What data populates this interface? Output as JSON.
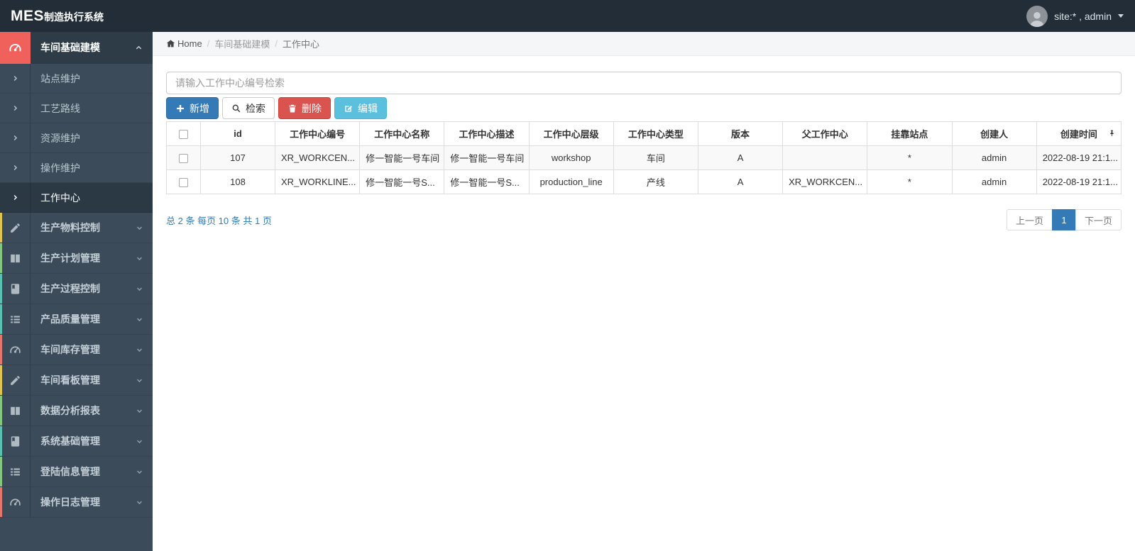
{
  "topbar": {
    "brand_primary": "MES",
    "brand_secondary": "制造执行系统",
    "user_label": "site:* , admin"
  },
  "breadcrumb": {
    "home_label": "Home",
    "separator": "/",
    "items": [
      "车间基础建模",
      "工作中心"
    ]
  },
  "sidebar": {
    "active_group": {
      "label": "车间基础建模",
      "icon": "tachometer-icon",
      "children": [
        {
          "label": "站点维护",
          "active": false
        },
        {
          "label": "工艺路线",
          "active": false
        },
        {
          "label": "资源维护",
          "active": false
        },
        {
          "label": "操作维护",
          "active": false
        },
        {
          "label": "工作中心",
          "active": true
        }
      ]
    },
    "items": [
      {
        "label": "生产物料控制",
        "icon": "pencil-icon",
        "strip_color": "#dfc452"
      },
      {
        "label": "生产计划管理",
        "icon": "columns-icon",
        "strip_color": "#84c87f"
      },
      {
        "label": "生产过程控制",
        "icon": "book-icon",
        "strip_color": "#58c2b1"
      },
      {
        "label": "产品质量管理",
        "icon": "list-icon",
        "strip_color": "#58c2b1"
      },
      {
        "label": "车间库存管理",
        "icon": "tachometer-icon",
        "strip_color": "#e4766c"
      },
      {
        "label": "车间看板管理",
        "icon": "pencil-icon",
        "strip_color": "#dfc452"
      },
      {
        "label": "数据分析报表",
        "icon": "columns-icon",
        "strip_color": "#84c87f"
      },
      {
        "label": "系统基础管理",
        "icon": "book-icon",
        "strip_color": "#58c2b1"
      },
      {
        "label": "登陆信息管理",
        "icon": "list-icon",
        "strip_color": "#84c87f"
      },
      {
        "label": "操作日志管理",
        "icon": "tachometer-icon",
        "strip_color": "#e4766c"
      }
    ]
  },
  "search": {
    "placeholder": "请输入工作中心编号检索",
    "value": ""
  },
  "toolbar": {
    "add_label": "新增",
    "search_label": "检索",
    "delete_label": "删除",
    "edit_label": "编辑"
  },
  "table": {
    "columns": [
      "id",
      "工作中心编号",
      "工作中心名称",
      "工作中心描述",
      "工作中心层级",
      "工作中心类型",
      "版本",
      "父工作中心",
      "挂靠站点",
      "创建人",
      "创建时间"
    ],
    "left_aligned_columns": [
      1,
      2,
      3,
      7
    ],
    "rows": [
      [
        "107",
        "XR_WORKCEN...",
        "修一智能一号车间",
        "修一智能一号车间",
        "workshop",
        "车间",
        "A",
        "",
        "*",
        "admin",
        "2022-08-19 21:1..."
      ],
      [
        "108",
        "XR_WORKLINE...",
        "修一智能一号S...",
        "修一智能一号S...",
        "production_line",
        "产线",
        "A",
        "XR_WORKCEN...",
        "*",
        "admin",
        "2022-08-19 21:1..."
      ]
    ]
  },
  "pagination": {
    "summary": "总 2 条 每页 10 条 共 1 页",
    "prev_label": "上一页",
    "current_page": "1",
    "next_label": "下一页"
  },
  "colors": {
    "topbar_bg": "#232d37",
    "sidebar_bg": "#3b4b59",
    "active_icon_red": "#f0615c",
    "accent_blue": "#337ab7",
    "danger_red": "#d9534f",
    "info_cyan": "#5bc0de"
  }
}
